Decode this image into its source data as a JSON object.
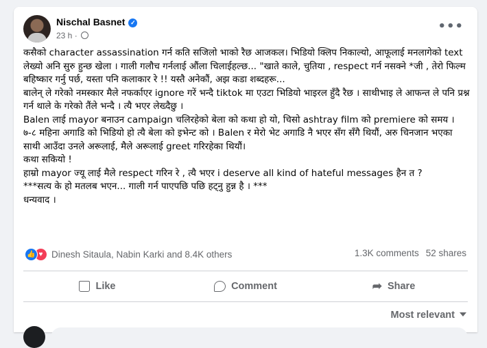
{
  "post": {
    "author": "Nischal Basnet",
    "time": "23 h",
    "more": "•••",
    "body": [
      "कसैको character assassination गर्न कति सजिलो भाको रैछ आजकल। भिडियो क्लिप निकाल्यो, आफूलाई मनलागेको text लेख्यो अनि सुरु हुन्छ खेला । गाली गलौच गर्नलाई औंला चिलाईहल्छ... \"खाते काले, चुतिया , respect गर्न नसक्ने *जी , तेरो फिल्म बहिष्कार गर्नु पर्छ, यस्ता पनि कलाकार रे !! यस्तै अनेकौं, अझ कडा शब्दहरू...",
      " बालेन् ले गरेको नमस्कार मैले नफर्काएर ignore गरें भन्दै tiktok मा एउटा भिडियो भाइरल हुँदै रैछ । साथीभाइ ले आफन्त ले पनि प्रश्न गर्न थाले के गरेको तैंले भन्दै । त्यै भएर लेख्दैछु ।",
      "Balen लाई mayor बनाउन campaign चलिरहेको बेला को कथा हो यो, चिसो ashtray film को premiere को समय ।",
      "७-८ महिना अगाडि को भिडियो हो त्यै बेला को इभेन्ट को । Balen  र मेरो भेट अगाडि नै भएर सँग सँगै थियौं, अरु चिनजान भएका साथी आउँदा उनले अरूलाई,  मैले अरूलाई greet गरिरहेका थियौं।",
      "कथा सकियो !",
      " हाम्रो mayor ज्यू लाई मैले respect गरिन रे , त्यै भएर i deserve all kind of hateful messages हैन त ?",
      "***सत्य के हो मतलब भएन... गाली गर्न पाएपछि पछि हट्नु हुन्न है । ***",
      "धन्यवाद ।"
    ],
    "reactions_text": "Dinesh Sitaula, Nabin Karki and 8.4K others",
    "comments_count": "1.3K comments",
    "shares_count": "52 shares"
  },
  "actions": {
    "like": "Like",
    "comment": "Comment",
    "share": "Share"
  },
  "sort": {
    "label": "Most relevant"
  },
  "colors": {
    "accent": "#1877f2",
    "love": "#f33e58",
    "muted": "#65676b"
  }
}
